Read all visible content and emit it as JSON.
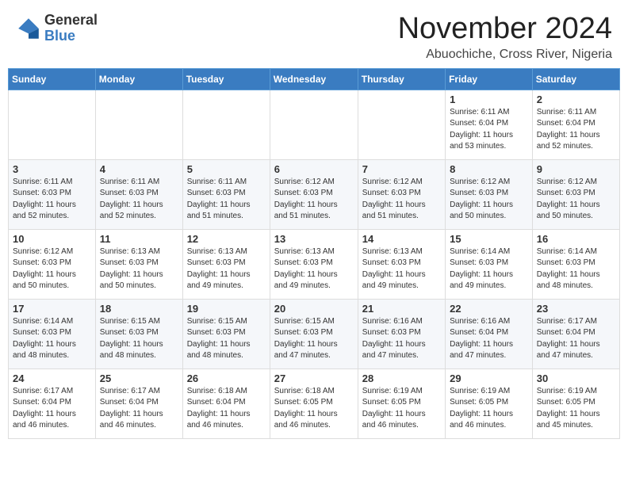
{
  "header": {
    "logo_general": "General",
    "logo_blue": "Blue",
    "month": "November 2024",
    "location": "Abuochiche, Cross River, Nigeria"
  },
  "weekdays": [
    "Sunday",
    "Monday",
    "Tuesday",
    "Wednesday",
    "Thursday",
    "Friday",
    "Saturday"
  ],
  "weeks": [
    [
      {
        "day": "",
        "info": ""
      },
      {
        "day": "",
        "info": ""
      },
      {
        "day": "",
        "info": ""
      },
      {
        "day": "",
        "info": ""
      },
      {
        "day": "",
        "info": ""
      },
      {
        "day": "1",
        "info": "Sunrise: 6:11 AM\nSunset: 6:04 PM\nDaylight: 11 hours\nand 53 minutes."
      },
      {
        "day": "2",
        "info": "Sunrise: 6:11 AM\nSunset: 6:04 PM\nDaylight: 11 hours\nand 52 minutes."
      }
    ],
    [
      {
        "day": "3",
        "info": "Sunrise: 6:11 AM\nSunset: 6:03 PM\nDaylight: 11 hours\nand 52 minutes."
      },
      {
        "day": "4",
        "info": "Sunrise: 6:11 AM\nSunset: 6:03 PM\nDaylight: 11 hours\nand 52 minutes."
      },
      {
        "day": "5",
        "info": "Sunrise: 6:11 AM\nSunset: 6:03 PM\nDaylight: 11 hours\nand 51 minutes."
      },
      {
        "day": "6",
        "info": "Sunrise: 6:12 AM\nSunset: 6:03 PM\nDaylight: 11 hours\nand 51 minutes."
      },
      {
        "day": "7",
        "info": "Sunrise: 6:12 AM\nSunset: 6:03 PM\nDaylight: 11 hours\nand 51 minutes."
      },
      {
        "day": "8",
        "info": "Sunrise: 6:12 AM\nSunset: 6:03 PM\nDaylight: 11 hours\nand 50 minutes."
      },
      {
        "day": "9",
        "info": "Sunrise: 6:12 AM\nSunset: 6:03 PM\nDaylight: 11 hours\nand 50 minutes."
      }
    ],
    [
      {
        "day": "10",
        "info": "Sunrise: 6:12 AM\nSunset: 6:03 PM\nDaylight: 11 hours\nand 50 minutes."
      },
      {
        "day": "11",
        "info": "Sunrise: 6:13 AM\nSunset: 6:03 PM\nDaylight: 11 hours\nand 50 minutes."
      },
      {
        "day": "12",
        "info": "Sunrise: 6:13 AM\nSunset: 6:03 PM\nDaylight: 11 hours\nand 49 minutes."
      },
      {
        "day": "13",
        "info": "Sunrise: 6:13 AM\nSunset: 6:03 PM\nDaylight: 11 hours\nand 49 minutes."
      },
      {
        "day": "14",
        "info": "Sunrise: 6:13 AM\nSunset: 6:03 PM\nDaylight: 11 hours\nand 49 minutes."
      },
      {
        "day": "15",
        "info": "Sunrise: 6:14 AM\nSunset: 6:03 PM\nDaylight: 11 hours\nand 49 minutes."
      },
      {
        "day": "16",
        "info": "Sunrise: 6:14 AM\nSunset: 6:03 PM\nDaylight: 11 hours\nand 48 minutes."
      }
    ],
    [
      {
        "day": "17",
        "info": "Sunrise: 6:14 AM\nSunset: 6:03 PM\nDaylight: 11 hours\nand 48 minutes."
      },
      {
        "day": "18",
        "info": "Sunrise: 6:15 AM\nSunset: 6:03 PM\nDaylight: 11 hours\nand 48 minutes."
      },
      {
        "day": "19",
        "info": "Sunrise: 6:15 AM\nSunset: 6:03 PM\nDaylight: 11 hours\nand 48 minutes."
      },
      {
        "day": "20",
        "info": "Sunrise: 6:15 AM\nSunset: 6:03 PM\nDaylight: 11 hours\nand 47 minutes."
      },
      {
        "day": "21",
        "info": "Sunrise: 6:16 AM\nSunset: 6:03 PM\nDaylight: 11 hours\nand 47 minutes."
      },
      {
        "day": "22",
        "info": "Sunrise: 6:16 AM\nSunset: 6:04 PM\nDaylight: 11 hours\nand 47 minutes."
      },
      {
        "day": "23",
        "info": "Sunrise: 6:17 AM\nSunset: 6:04 PM\nDaylight: 11 hours\nand 47 minutes."
      }
    ],
    [
      {
        "day": "24",
        "info": "Sunrise: 6:17 AM\nSunset: 6:04 PM\nDaylight: 11 hours\nand 46 minutes."
      },
      {
        "day": "25",
        "info": "Sunrise: 6:17 AM\nSunset: 6:04 PM\nDaylight: 11 hours\nand 46 minutes."
      },
      {
        "day": "26",
        "info": "Sunrise: 6:18 AM\nSunset: 6:04 PM\nDaylight: 11 hours\nand 46 minutes."
      },
      {
        "day": "27",
        "info": "Sunrise: 6:18 AM\nSunset: 6:05 PM\nDaylight: 11 hours\nand 46 minutes."
      },
      {
        "day": "28",
        "info": "Sunrise: 6:19 AM\nSunset: 6:05 PM\nDaylight: 11 hours\nand 46 minutes."
      },
      {
        "day": "29",
        "info": "Sunrise: 6:19 AM\nSunset: 6:05 PM\nDaylight: 11 hours\nand 46 minutes."
      },
      {
        "day": "30",
        "info": "Sunrise: 6:19 AM\nSunset: 6:05 PM\nDaylight: 11 hours\nand 45 minutes."
      }
    ]
  ]
}
